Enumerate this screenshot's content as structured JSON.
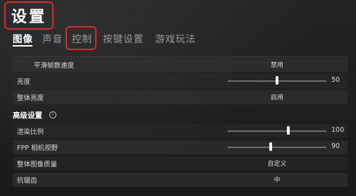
{
  "title": "设置",
  "tabs": [
    {
      "label": "图像",
      "active": true
    },
    {
      "label": "声音",
      "active": false
    },
    {
      "label": "控制",
      "active": false,
      "highlighted": true
    },
    {
      "label": "按键设置",
      "active": false
    },
    {
      "label": "游戏玩法",
      "active": false
    }
  ],
  "rows_top": [
    {
      "label": "平滑帧数速度",
      "value": "禁用"
    },
    {
      "label": "亮度",
      "slider_value": 50,
      "slider_fraction": 0.5
    },
    {
      "label": "整体亮度",
      "value": "启用"
    }
  ],
  "advanced_section": {
    "label": "高级设置",
    "icon": "info-icon"
  },
  "rows_advanced": [
    {
      "label": "渲染比例",
      "slider_value": 100,
      "slider_fraction": 0.6
    },
    {
      "label": "FPP 相机视野",
      "slider_value": 90,
      "slider_fraction": 0.44
    },
    {
      "label": "整体图像质量",
      "value": "自定义"
    },
    {
      "label": "抗锯齿",
      "value": "中"
    }
  ],
  "colors": {
    "highlight": "#e0262b",
    "background": "#1b1c1e"
  }
}
